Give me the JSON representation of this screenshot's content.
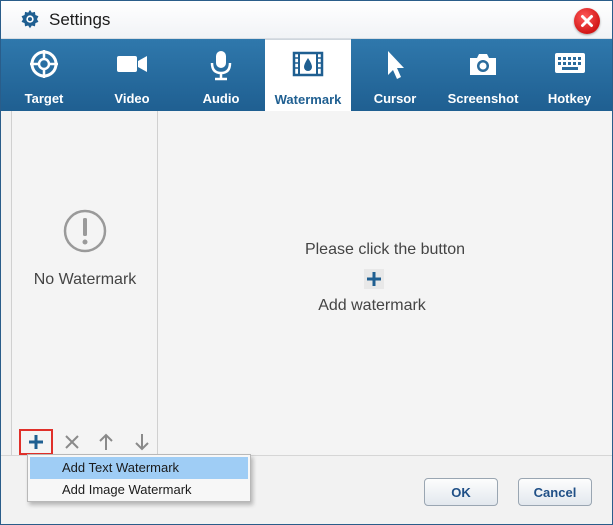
{
  "window": {
    "title": "Settings"
  },
  "tabs": [
    {
      "label": "Target",
      "icon": "crosshair-icon"
    },
    {
      "label": "Video",
      "icon": "video-camera-icon"
    },
    {
      "label": "Audio",
      "icon": "microphone-icon"
    },
    {
      "label": "Watermark",
      "icon": "film-drop-icon",
      "active": true
    },
    {
      "label": "Cursor",
      "icon": "cursor-arrow-icon"
    },
    {
      "label": "Screenshot",
      "icon": "camera-icon"
    },
    {
      "label": "Hotkey",
      "icon": "keyboard-icon"
    }
  ],
  "left_panel": {
    "empty_text": "No Watermark",
    "toolbar": [
      "add-icon",
      "delete-icon",
      "move-up-icon",
      "move-down-icon"
    ]
  },
  "main_panel": {
    "hint": "Please click  the button",
    "action_label": "Add watermark"
  },
  "menu": {
    "items": [
      "Add Text Watermark",
      "Add Image Watermark"
    ],
    "highlighted_index": 0
  },
  "footer": {
    "ok_label": "OK",
    "cancel_label": "Cancel"
  },
  "colors": {
    "tab_bar": "#2a6b9c",
    "accent": "#1f5f91",
    "close": "#e02020",
    "highlight": "#9fcdf5",
    "add_button_border": "#e0302a"
  }
}
